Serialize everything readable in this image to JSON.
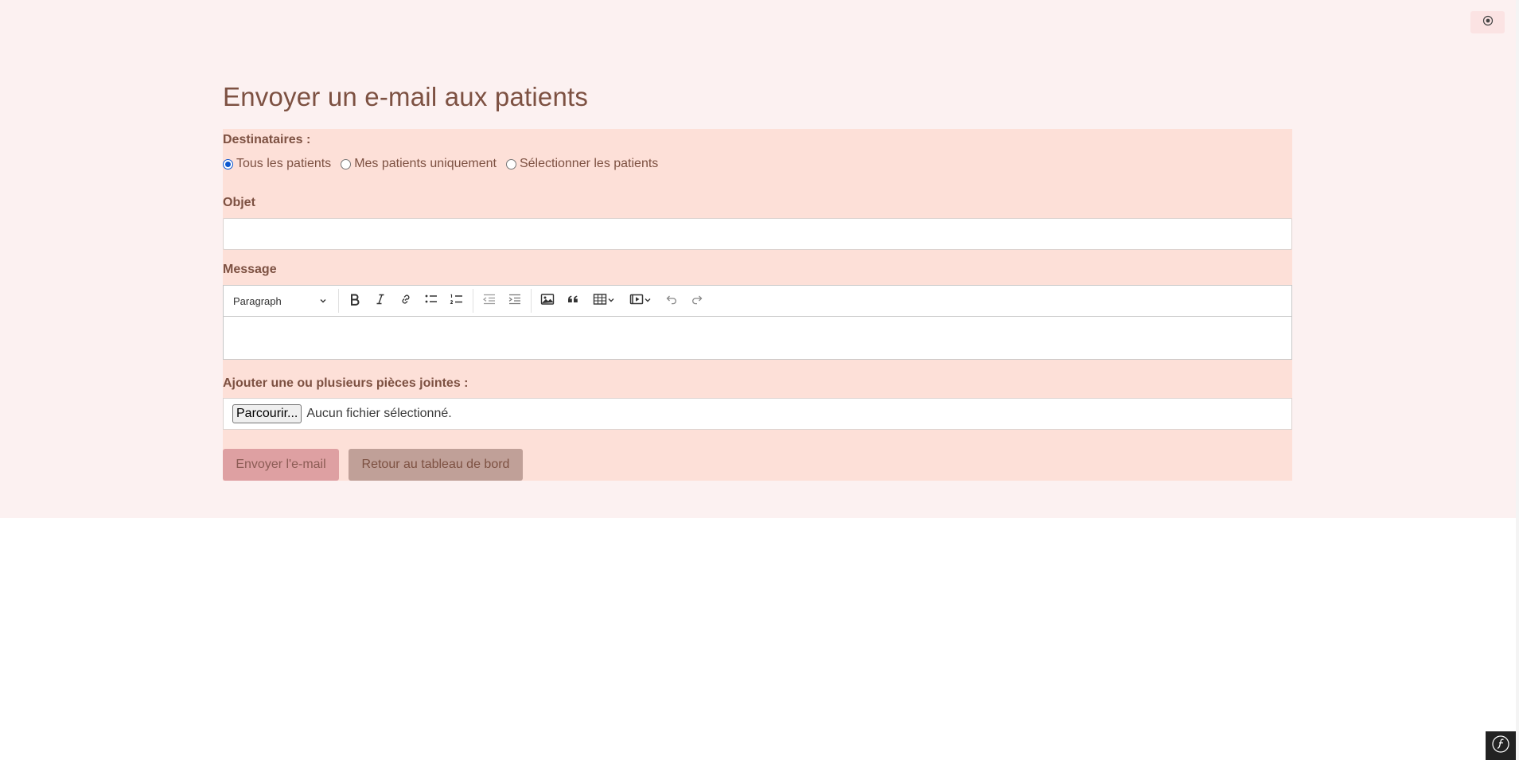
{
  "page": {
    "title": "Envoyer un e-mail aux patients"
  },
  "header": {
    "theme_toggle_icon": "theme-toggle-icon"
  },
  "form": {
    "recipients_label": "Destinataires :",
    "recipient_options": [
      {
        "label": "Tous les patients",
        "checked": true
      },
      {
        "label": "Mes patients uniquement",
        "checked": false
      },
      {
        "label": "Sélectionner les patients",
        "checked": false
      }
    ],
    "subject_label": "Objet",
    "subject_value": "",
    "message_label": "Message",
    "editor": {
      "heading_select": "Paragraph",
      "tools": [
        "bold-icon",
        "italic-icon",
        "link-icon",
        "bulleted-list-icon",
        "numbered-list-icon",
        "outdent-icon",
        "indent-icon",
        "image-icon",
        "blockquote-icon",
        "table-icon",
        "media-icon",
        "undo-icon",
        "redo-icon"
      ],
      "content": ""
    },
    "attachments_label": "Ajouter une ou plusieurs pièces jointes :",
    "browse_button": "Parcourir...",
    "file_status": "Aucun fichier sélectionné.",
    "send_button": "Envoyer l'e-mail",
    "back_button": "Retour au tableau de bord"
  },
  "footer": {
    "debug_badge_icon": "symfony-icon"
  },
  "colors": {
    "page_background": "#fcf1f1",
    "panel_background": "#fde0d8",
    "text_brown": "#7d5142",
    "send_button": "#dea0a2",
    "back_button": "#c0a098",
    "radio_checked": "#0b57d0"
  }
}
